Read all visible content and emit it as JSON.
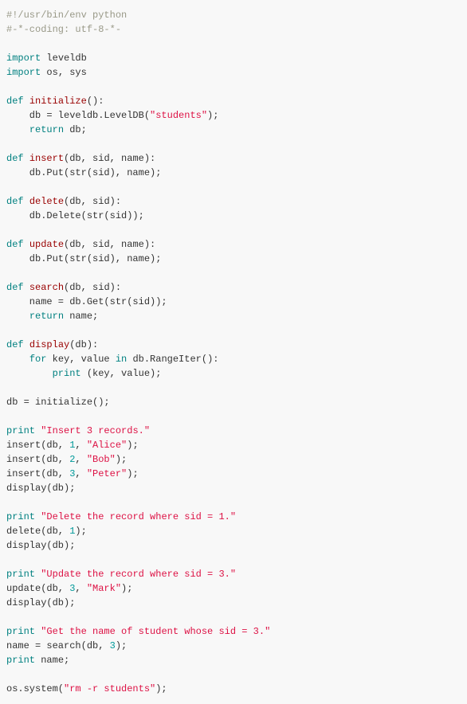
{
  "code": {
    "l1_shebang": "#!/usr/bin/env python",
    "l2_coding": "#-*-coding: utf-8-*-",
    "kw_import": "import",
    "mod_leveldb": " leveldb",
    "mod_os_sys": " os, sys",
    "kw_def": "def",
    "kw_return": "return",
    "kw_for": "for",
    "kw_in": "in",
    "kw_print": "print",
    "fn_initialize": "initialize",
    "fn_insert": "insert",
    "fn_delete": "delete",
    "fn_update": "update",
    "fn_search": "search",
    "fn_display": "display",
    "sig_initialize": "():",
    "sig_insert": "(db, sid, name):",
    "sig_delete": "(db, sid):",
    "sig_update": "(db, sid, name):",
    "sig_search": "(db, sid):",
    "sig_display": "(db):",
    "body_init1a": "    db = leveldb.LevelDB(",
    "str_students": "\"students\"",
    "body_init1b": ");",
    "body_init2": " db;",
    "body_insert1": "    db.Put(str(sid), name);",
    "body_delete1": "    db.Delete(str(sid));",
    "body_update1": "    db.Put(str(sid), name);",
    "body_search1": "    name = db.Get(str(sid));",
    "body_search2": " name;",
    "body_display_for_a": " key, value ",
    "body_display_for_b": " db.RangeIter():",
    "body_display_print": " (key, value);",
    "main_assign": "db = initialize();",
    "str_insert3": "\"Insert 3 records.\"",
    "call_ins1a": "insert(db, ",
    "num1": "1",
    "num2": "2",
    "num3": "3",
    "comma_sp": ", ",
    "str_alice": "\"Alice\"",
    "str_bob": "\"Bob\"",
    "str_peter": "\"Peter\"",
    "str_mark": "\"Mark\"",
    "call_close": ");",
    "call_display": "display(db);",
    "str_delete1": "\"Delete the record where sid = 1.\"",
    "call_del1a": "delete(db, ",
    "call_del1b": ");",
    "str_update3": "\"Update the record where sid = 3.\"",
    "call_upd1a": "update(db, ",
    "str_getname": "\"Get the name of student whose sid = 3.\"",
    "call_search_a": "name = search(db, ",
    "call_search_b": ");",
    "print_name": " name;",
    "os_system_a": "os.system(",
    "str_rm": "\"rm -r students\"",
    "os_system_b": ");",
    "indent4": "    ",
    "indent8": "        ",
    "sp": " "
  }
}
